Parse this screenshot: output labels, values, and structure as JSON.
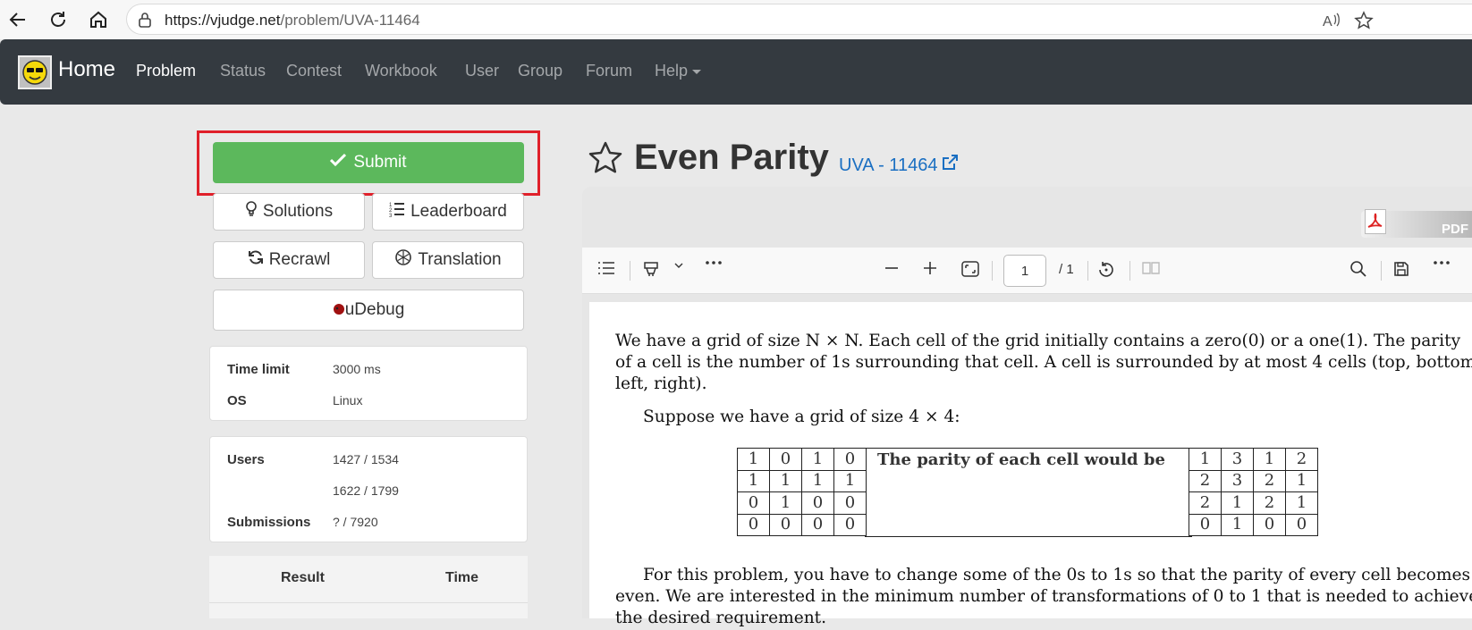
{
  "browser": {
    "url_host": "https://vjudge.net",
    "url_path": "/problem/UVA-11464"
  },
  "navbar": {
    "brand": "Home",
    "items": [
      "Problem",
      "Status",
      "Contest",
      "Workbook",
      "User",
      "Group",
      "Forum",
      "Help"
    ]
  },
  "actions": {
    "submit": "Submit",
    "solutions": "Solutions",
    "leaderboard": "Leaderboard",
    "recrawl": "Recrawl",
    "translation": "Translation",
    "udebug": "uDebug"
  },
  "info": {
    "time_limit_label": "Time limit",
    "time_limit_value": "3000 ms",
    "os_label": "OS",
    "os_value": "Linux"
  },
  "stats": {
    "users_label": "Users",
    "users_value": "1427 / 1534",
    "second_value": "1622 / 1799",
    "submissions_label": "Submissions",
    "submissions_value": "? / 7920"
  },
  "results_table": {
    "col_result": "Result",
    "col_time": "Time"
  },
  "problem": {
    "title": "Even Parity",
    "origin": "UVA - 11464"
  },
  "pdf": {
    "badge": "PDF",
    "page_current": "1",
    "page_total": "/ 1",
    "para1_line1": "We have a grid of size N × N. Each cell of the grid initially contains a zero(0) or a one(1). The parity",
    "para1_line2": "of a cell is the number of 1s surrounding that cell. A cell is surrounded by at most 4 cells (top, bottom,",
    "para1_line3": "left, right).",
    "para2": "Suppose we have a grid of size 4 × 4:",
    "parity_text": "The parity of each cell would be",
    "grid_left": [
      [
        "1",
        "0",
        "1",
        "0"
      ],
      [
        "1",
        "1",
        "1",
        "1"
      ],
      [
        "0",
        "1",
        "0",
        "0"
      ],
      [
        "0",
        "0",
        "0",
        "0"
      ]
    ],
    "grid_right": [
      [
        "1",
        "3",
        "1",
        "2"
      ],
      [
        "2",
        "3",
        "2",
        "1"
      ],
      [
        "2",
        "1",
        "2",
        "1"
      ],
      [
        "0",
        "1",
        "0",
        "0"
      ]
    ],
    "para3_line1": "For this problem, you have to change some of the 0s to 1s so that the parity of every cell becomes",
    "para3_line2": "even. We are interested in the minimum number of transformations of 0 to 1 that is needed to achieve",
    "para3_line3": "the desired requirement."
  },
  "colors": {
    "submit_green": "#5cb85c",
    "highlight_red": "#e0202a",
    "navbar_dark": "#343a40",
    "link_blue": "#1a6fc2"
  }
}
